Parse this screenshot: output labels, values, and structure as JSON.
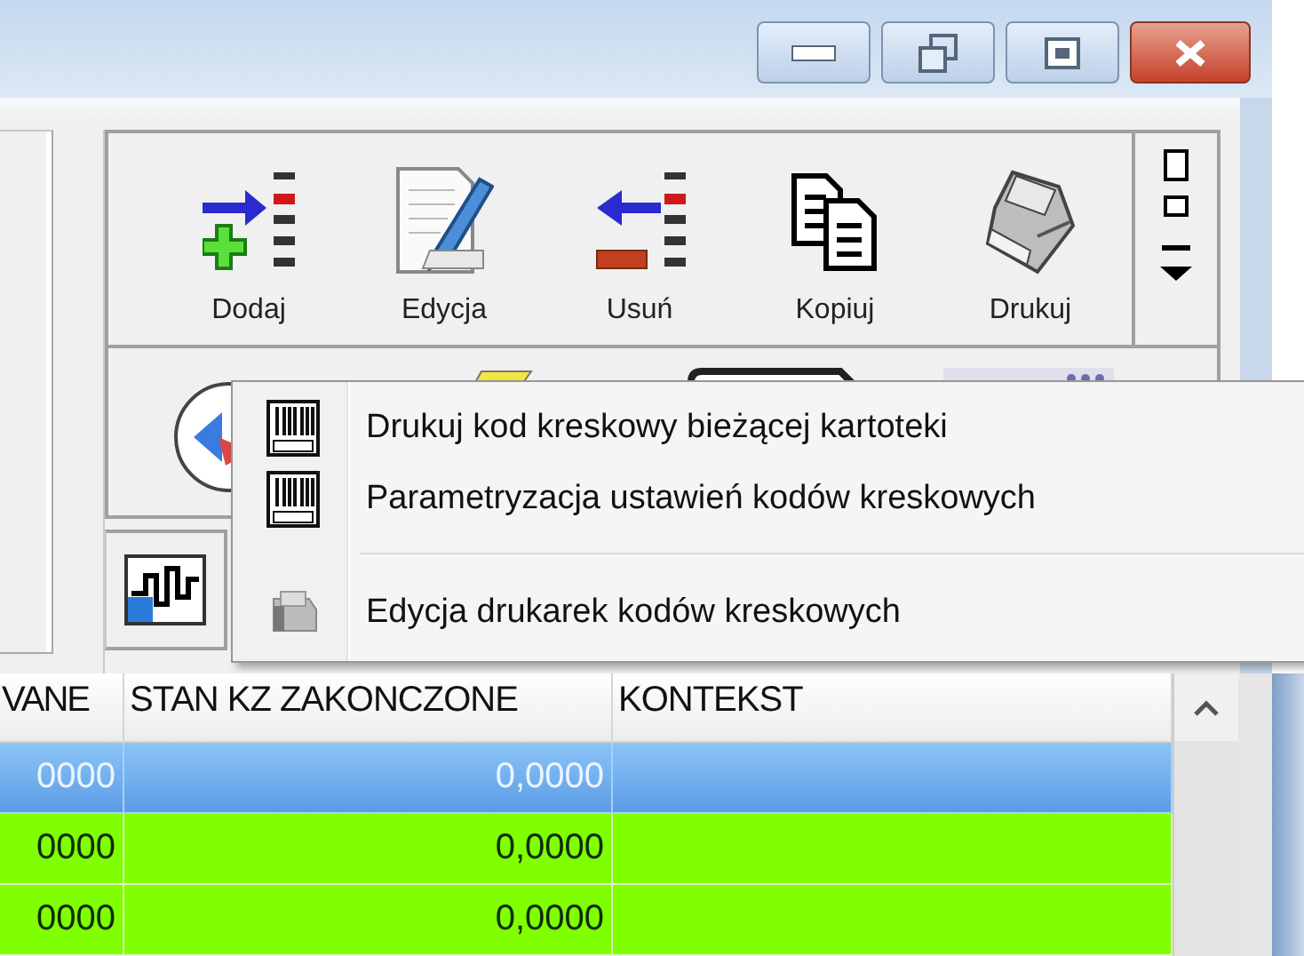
{
  "toolbar": {
    "buttons": [
      {
        "kind": "add",
        "label": "Dodaj"
      },
      {
        "kind": "edit",
        "label": "Edycja"
      },
      {
        "kind": "remove",
        "label": "Usuń"
      },
      {
        "kind": "copy",
        "label": "Kopiuj"
      },
      {
        "kind": "print",
        "label": "Drukuj"
      }
    ]
  },
  "context_menu": {
    "items": [
      {
        "kind": "barcode",
        "label": "Drukuj kod kreskowy bieżącej kartoteki"
      },
      {
        "kind": "barcode",
        "label": "Parametryzacja ustawień kodów kreskowych"
      },
      {
        "kind": "separator"
      },
      {
        "kind": "printer",
        "label": "Edycja drukarek kodów kreskowych"
      }
    ]
  },
  "table": {
    "columns": [
      "VANE",
      "STAN KZ ZAKONCZONE",
      "KONTEKST"
    ],
    "rows": [
      {
        "selected": true,
        "cells": [
          "0000",
          "0,0000"
        ]
      },
      {
        "selected": false,
        "cells": [
          "0000",
          "0,0000"
        ]
      },
      {
        "selected": false,
        "cells": [
          "0000",
          "0,0000"
        ]
      }
    ]
  }
}
